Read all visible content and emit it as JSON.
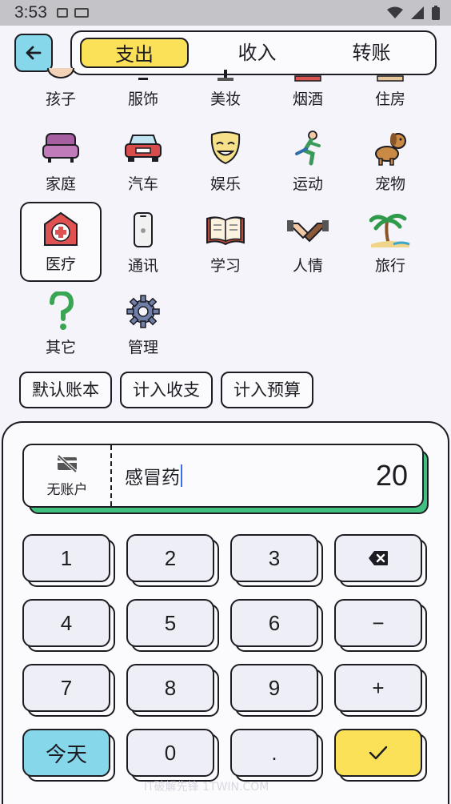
{
  "status_bar": {
    "time": "3:53"
  },
  "header": {
    "back_icon": "arrow-left-icon",
    "tabs": [
      {
        "label": "支出",
        "active": true
      },
      {
        "label": "收入",
        "active": false
      },
      {
        "label": "转账",
        "active": false
      }
    ]
  },
  "categories": {
    "row1": [
      {
        "label": "孩子",
        "icon": "baby-icon"
      },
      {
        "label": "服饰",
        "icon": "clothes-icon"
      },
      {
        "label": "美妆",
        "icon": "makeup-icon"
      },
      {
        "label": "烟酒",
        "icon": "tobacco-wine-icon"
      },
      {
        "label": "住房",
        "icon": "house-icon"
      }
    ],
    "row2": [
      {
        "label": "家庭",
        "icon": "sofa-icon"
      },
      {
        "label": "汽车",
        "icon": "car-icon"
      },
      {
        "label": "娱乐",
        "icon": "mask-icon"
      },
      {
        "label": "运动",
        "icon": "runner-icon"
      },
      {
        "label": "宠物",
        "icon": "dog-icon"
      }
    ],
    "row3": [
      {
        "label": "医疗",
        "icon": "hospital-icon",
        "selected": true
      },
      {
        "label": "通讯",
        "icon": "phone-icon"
      },
      {
        "label": "学习",
        "icon": "book-icon"
      },
      {
        "label": "人情",
        "icon": "handshake-icon"
      },
      {
        "label": "旅行",
        "icon": "palm-tree-icon"
      }
    ],
    "row4": [
      {
        "label": "其它",
        "icon": "question-icon"
      },
      {
        "label": "管理",
        "icon": "gear-icon"
      }
    ]
  },
  "chips": [
    "默认账本",
    "计入收支",
    "计入预算"
  ],
  "entry": {
    "account_label": "无账户",
    "account_icon": "no-card-icon",
    "note": "感冒药",
    "amount": "20",
    "accent_color": "#3fc07e"
  },
  "keypad": {
    "keys": [
      "1",
      "2",
      "3",
      "⌫",
      "4",
      "5",
      "6",
      "−",
      "7",
      "8",
      "9",
      "+",
      "今天",
      "0",
      ".",
      "✓"
    ]
  },
  "watermark": "IT破解先锋  1TWIN.COM"
}
